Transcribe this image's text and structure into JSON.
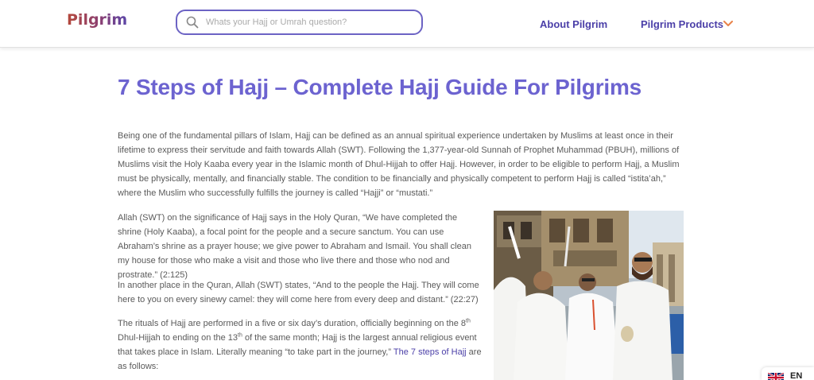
{
  "header": {
    "logo": "Pilgrim",
    "search_placeholder": "Whats your Hajj or Umrah question?",
    "nav_about": "About Pilgrim",
    "nav_products": "Pilgrim Products"
  },
  "article": {
    "title": "7 Steps of Hajj – Complete Hajj Guide For Pilgrims",
    "p1": "Being one of the fundamental pillars of Islam, Hajj can be defined as an annual spiritual experience undertaken by Muslims at least once in their lifetime to express their servitude and faith towards Allah (SWT). Following the 1,377-year-old Sunnah of Prophet Muhammad (PBUH), millions of Muslims visit the Holy Kaaba every year in the Islamic month of Dhul-Hijjah to offer Hajj. However, in order to be eligible to perform Hajj, a Muslim must be physically, mentally, and financially stable. The condition to be financially and physically competent to perform Hajj is called “istita’ah,” where the Muslim who successfully fulfills the journey is called “Hajji” or “mustati.”",
    "p2": "Allah (SWT) on the significance of Hajj says in the Holy Quran, “We have completed the shrine (Holy Kaaba), a focal point for the people and a secure sanctum. You can use Abraham’s shrine as a prayer house; we give power to Abraham and Ismail. You shall clean my house for those who make a visit and those who live there and those who nod and prostrate.” (2:125)",
    "p3": "In another place in the Quran, Allah (SWT) states, “And to the people the Hajj. They will come here to you on every sinewy camel: they will come here from every deep and distant.” (22:27)",
    "p4_a": "The rituals of Hajj are performed in a five or six day’s duration, officially beginning on the 8",
    "p4_sup1": "th",
    "p4_b": " Dhul-Hijjah to ending on the 13",
    "p4_sup2": "th",
    "p4_c": " of the same month; Hajj is the largest annual religious event that takes place in Islam. Literally meaning “to take part in the journey,” ",
    "p4_link": "The 7 steps of Hajj",
    "p4_d": " are as follows:"
  },
  "language": {
    "code": "EN"
  },
  "colors": {
    "accent": "#6c63d0",
    "nav": "#4b3fa8",
    "chevron": "#e8834a"
  }
}
